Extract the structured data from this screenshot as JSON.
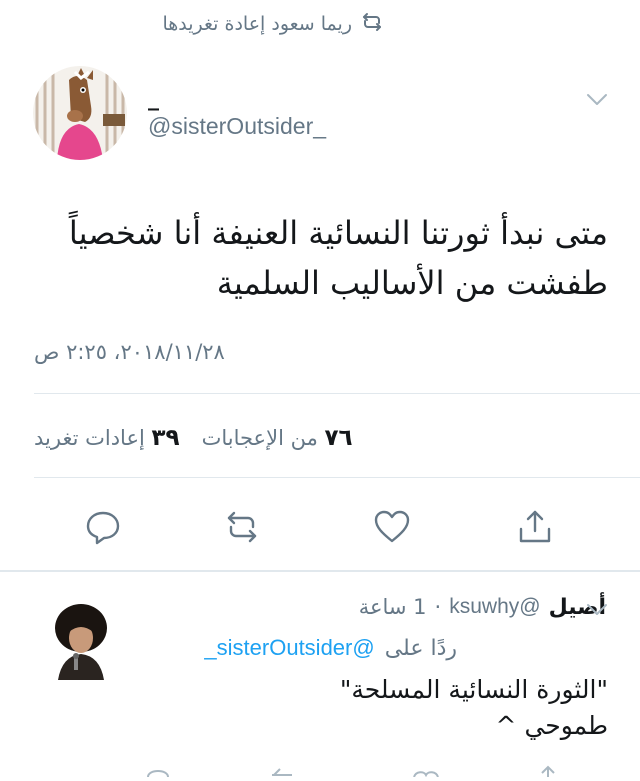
{
  "retweet_context": {
    "text": "ريما سعود إعادة تغريدها",
    "icon": "retweet-icon"
  },
  "tweet": {
    "display_name": "_",
    "handle": "@sisterOutsider_",
    "text": "متى نبدأ ثورتنا النسائية العنيفة أنا شخصياً طفشت من الأساليب السلمية",
    "timestamp": "٢٠١٨/١١/٢٨، ٢:٢٥ ص",
    "retweets_count": "٣٩",
    "retweets_label": "إعادات تغريد",
    "likes_count": "٧٦",
    "likes_label": "من الإعجابات",
    "actions": [
      "reply-icon",
      "retweet-icon",
      "like-icon",
      "share-icon"
    ]
  },
  "reply": {
    "display_name": "أصيل",
    "handle": "@ksuwhy",
    "time": "1 ساعة",
    "separator": "·",
    "replying_label": "ردًا على",
    "replying_to": "@sisterOutsider_",
    "text_line1": "\"الثورة النسائية المسلحة\"",
    "text_line2": "طموحي ^"
  },
  "colors": {
    "accent": "#1da1f2",
    "secondary_text": "#657786",
    "divider": "#e1e8ed"
  }
}
